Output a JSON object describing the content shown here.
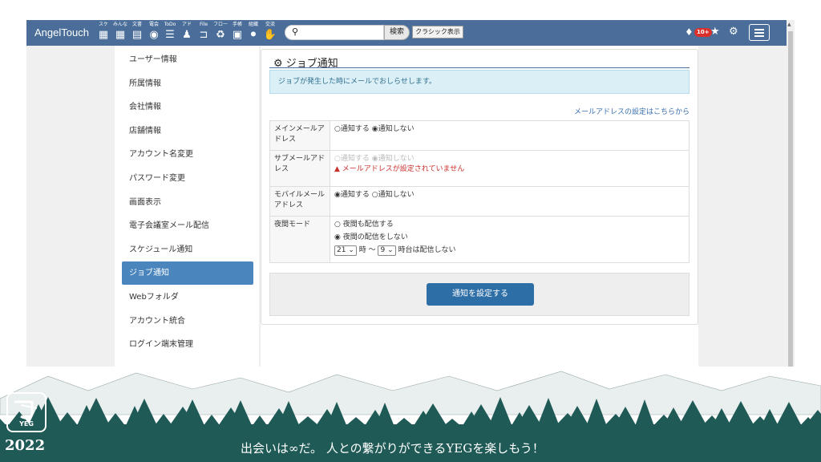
{
  "topbar": {
    "brand": "AngelTouch",
    "apps": [
      {
        "label": "スケ",
        "icon": "calendar-grid-icon",
        "glyph": "▦"
      },
      {
        "label": "みんな",
        "icon": "calendar-group-icon",
        "glyph": "▦"
      },
      {
        "label": "文書",
        "icon": "document-icon",
        "glyph": "▤"
      },
      {
        "label": "電会",
        "icon": "chat-bubble-icon",
        "glyph": "◉"
      },
      {
        "label": "ToDo",
        "icon": "todo-list-icon",
        "glyph": "☰"
      },
      {
        "label": "アド",
        "icon": "user-icon",
        "glyph": "♟"
      },
      {
        "label": "File",
        "icon": "folder-icon",
        "glyph": "⊐"
      },
      {
        "label": "フロー",
        "icon": "recycle-flow-icon",
        "glyph": "♻"
      },
      {
        "label": "手帳",
        "icon": "contact-book-icon",
        "glyph": "▣"
      },
      {
        "label": "組織",
        "icon": "org-chart-icon",
        "glyph": "⚫"
      },
      {
        "label": "交流",
        "icon": "handshake-icon",
        "glyph": "✋"
      }
    ],
    "search_placeholder": "",
    "search_button": "検索",
    "classic_button": "クラシック表示",
    "notification_badge": "10+"
  },
  "sidebar": {
    "items": [
      {
        "label": "ユーザー情報"
      },
      {
        "label": "所属情報"
      },
      {
        "label": "会社情報"
      },
      {
        "label": "店舗情報"
      },
      {
        "label": "アカウント名変更"
      },
      {
        "label": "パスワード変更"
      },
      {
        "label": "画面表示"
      },
      {
        "label": "電子会議室メール配信"
      },
      {
        "label": "スケジュール通知"
      },
      {
        "label": "ジョブ通知",
        "active": true
      },
      {
        "label": "Webフォルダ"
      },
      {
        "label": "アカウント統合"
      },
      {
        "label": "ログイン端末管理"
      }
    ]
  },
  "main": {
    "title": "ジョブ通知",
    "info": "ジョブが発生した時にメールでおしらせします。",
    "mail_link": "メールアドレスの設定はこちらから",
    "rows": {
      "main_mail": {
        "label": "メインメールアドレス",
        "opt_on": "通知する",
        "opt_off": "通知しない",
        "selected": "off"
      },
      "sub_mail": {
        "label": "サブメールアドレス",
        "opt_on": "通知する",
        "opt_off": "通知しない",
        "selected": "off",
        "warning": "メールアドレスが設定されていません"
      },
      "mobile_mail": {
        "label": "モバイルメールアドレス",
        "opt_on": "通知する",
        "opt_off": "通知しない",
        "selected": "on"
      },
      "night": {
        "label": "夜間モード",
        "opt_on": "夜間も配信する",
        "opt_off": "夜間の配信をしない",
        "selected": "off",
        "from_hour": "21",
        "unit_from": "時 〜",
        "to_hour": "9",
        "unit_to": "時台は配信しない"
      }
    },
    "save_button": "通知を設定する"
  },
  "banner": {
    "logo_text": "YEG",
    "year": "2022",
    "slogan": "出会いは∞だ。 人との繋がりができるYEGを楽しもう！",
    "color": "#1f5a56"
  }
}
